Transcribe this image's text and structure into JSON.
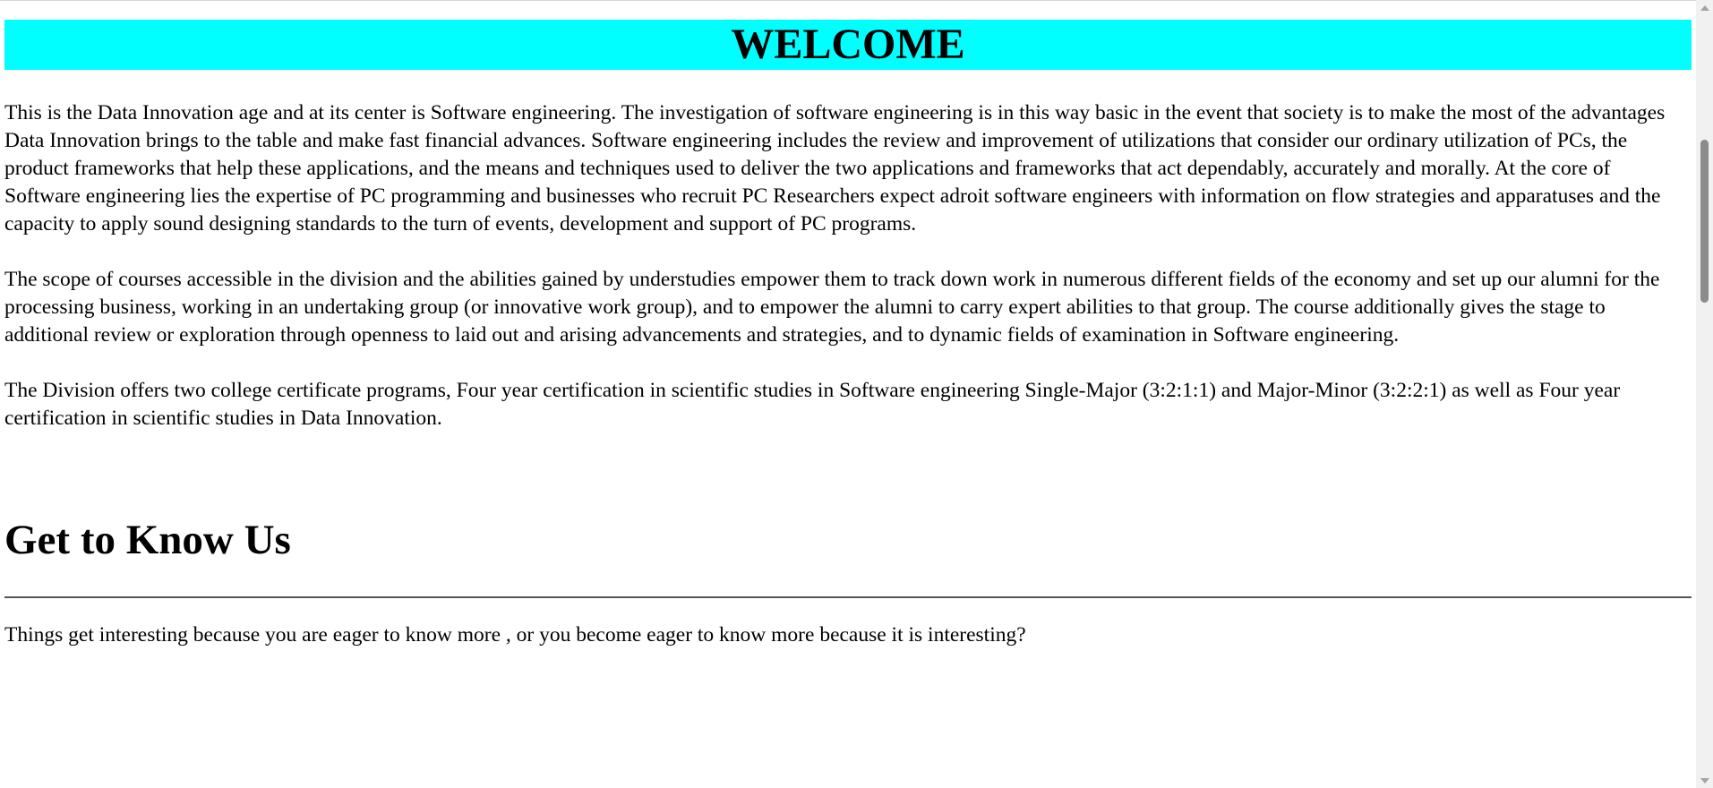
{
  "banner": {
    "title": "WELCOME",
    "background": "#00ffff"
  },
  "intro": {
    "paragraphs": [
      "This is the Data Innovation age and at its center is Software engineering. The investigation of software engineering is in this way basic in the event that society is to make the most of the advantages Data Innovation brings to the table and make fast financial advances. Software engineering includes the review and improvement of utilizations that consider our ordinary utilization of PCs, the product frameworks that help these applications, and the means and techniques used to deliver the two applications and frameworks that act dependably, accurately and morally. At the core of Software engineering lies the expertise of PC programming and businesses who recruit PC Researchers expect adroit software engineers with information on flow strategies and apparatuses and the capacity to apply sound designing standards to the turn of events, development and support of PC programs.",
      "The scope of courses accessible in the division and the abilities gained by understudies empower them to track down work in numerous different fields of the economy and set up our alumni for the processing business, working in an undertaking group (or innovative work group), and to empower the alumni to carry expert abilities to that group. The course additionally gives the stage to additional review or exploration through openness to laid out and arising advancements and strategies, and to dynamic fields of examination in Software engineering.",
      "The Division offers two college certificate programs, Four year certification in scientific studies in Software engineering Single-Major (3:2:1:1) and Major-Minor (3:2:2:1) as well as Four year certification in scientific studies in Data Innovation."
    ]
  },
  "about": {
    "title": "Get to Know Us",
    "tagline": "Things get interesting because you are eager to know more , or you become eager to know more because it is interesting?"
  },
  "scrollbar": {
    "up_icon": "scroll-up-arrow-icon",
    "down_icon": "scroll-down-arrow-icon"
  }
}
